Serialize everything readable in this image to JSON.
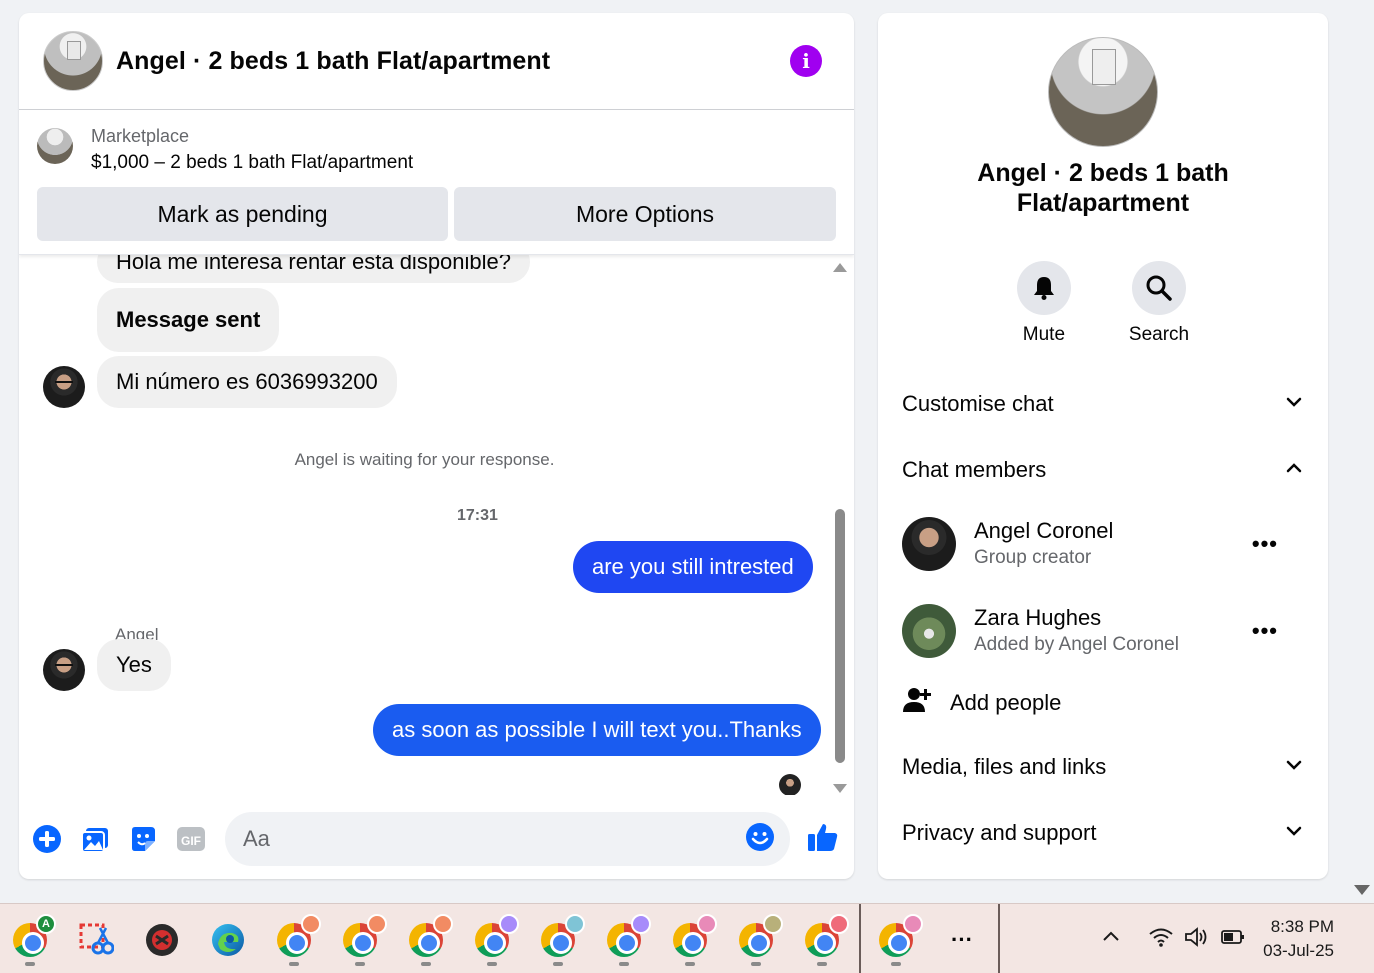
{
  "chat": {
    "title": "Angel · 2 beds 1 bath Flat/apartment",
    "info_icon": "i",
    "marketplace": {
      "label": "Marketplace",
      "listing": "$1,000 – 2 beds 1 bath Flat/apartment",
      "mark_pending": "Mark as pending",
      "more_options": "More Options"
    },
    "messages": {
      "m1": "Hola me interesa rentar esta disponible?",
      "m2": "Message sent",
      "m3": "Mi número es 6036993200",
      "waiting": "Angel is waiting for your response.",
      "time": "17:31",
      "m4": "are you still intrested",
      "sender": "Angel",
      "m5": "Yes",
      "m6": "as soon as possible I will text you..Thanks"
    },
    "composer": {
      "placeholder": "Aa",
      "gif_label": "GIF"
    }
  },
  "info": {
    "title": "Angel · 2 beds 1 bath Flat/apartment",
    "mute": "Mute",
    "search": "Search",
    "customise": "Customise chat",
    "chat_members": "Chat members",
    "members": [
      {
        "name": "Angel Coronel",
        "role": "Group creator"
      },
      {
        "name": "Zara Hughes",
        "role": "Added by Angel Coronel"
      }
    ],
    "add_people": "Add people",
    "media": "Media, files and links",
    "privacy": "Privacy and support"
  },
  "taskbar": {
    "profile_badge": "A",
    "more": "···",
    "time": "8:38 PM",
    "date": "03-Jul-25"
  },
  "colors": {
    "outgoing_bubble": "#1f47f2",
    "accent": "#0866ff",
    "info_button": "#a000f0"
  }
}
